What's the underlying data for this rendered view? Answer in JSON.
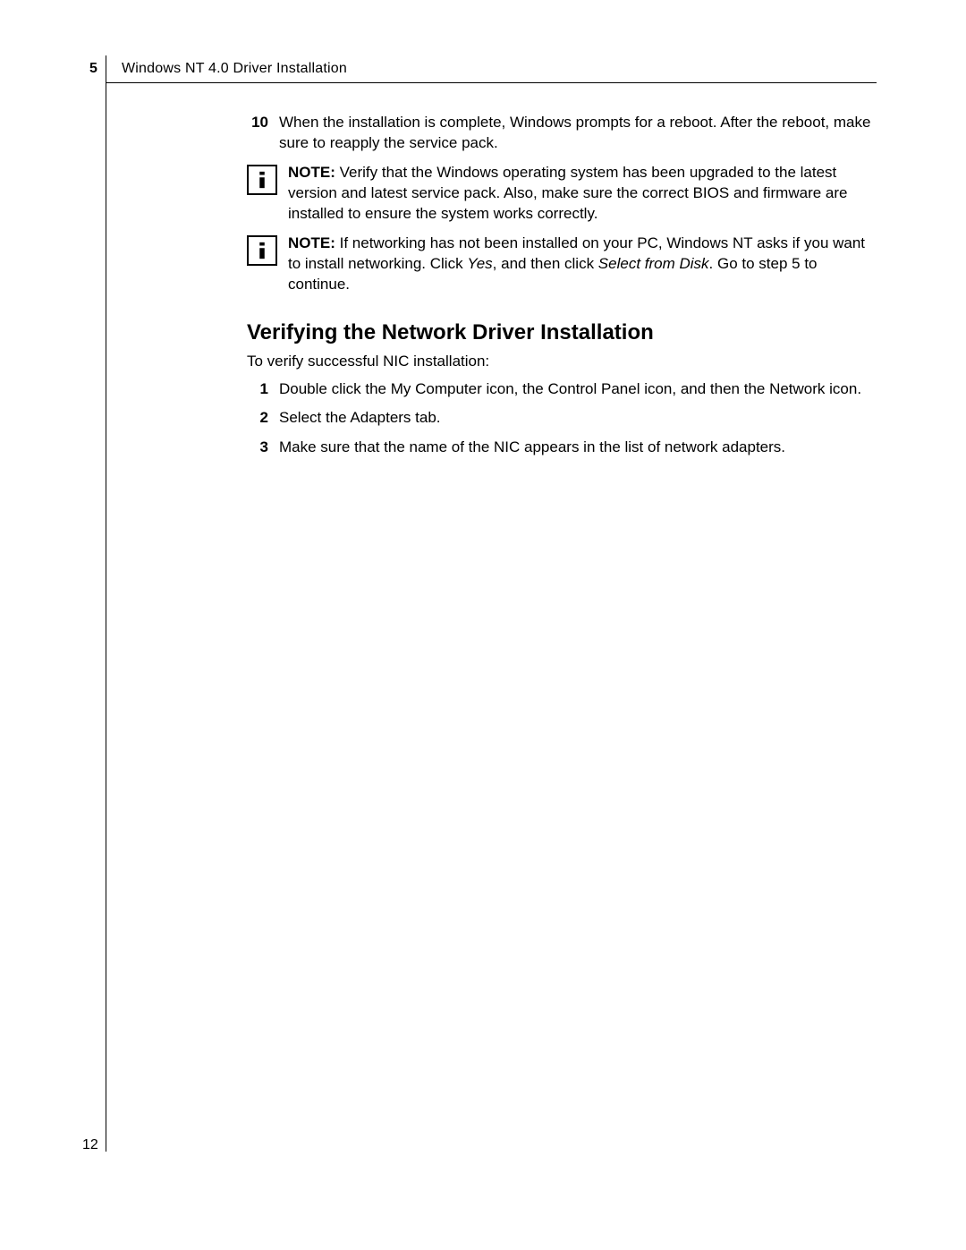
{
  "header": {
    "chapter_number": "5",
    "chapter_title": "Windows NT 4.0 Driver Installation"
  },
  "step10": {
    "num": "10",
    "text": "When the installation is complete, Windows prompts for a reboot. After the reboot, make sure to reapply the service pack."
  },
  "note1": {
    "label": "NOTE:",
    "text": " Verify that the Windows operating system has been upgraded to the latest version and latest service pack. Also, make sure the correct BIOS and firmware are installed to ensure the system works correctly."
  },
  "note2": {
    "label": "NOTE:",
    "pre": " If networking has not been installed on your PC, Windows NT asks if you want to install networking. Click ",
    "yes": "Yes",
    "mid": ", and then click ",
    "select": "Select from Disk",
    "post": ". Go to step 5 to continue."
  },
  "section": {
    "heading": "Verifying the Network Driver Installation",
    "intro": "To verify successful NIC installation:",
    "items": [
      {
        "num": "1",
        "text": "Double click the My Computer icon, the Control Panel icon, and then the Network icon."
      },
      {
        "num": "2",
        "text": "Select the Adapters tab."
      },
      {
        "num": "3",
        "text": "Make sure that the name of the NIC appears in the list of network adapters."
      }
    ]
  },
  "page_number": "12"
}
